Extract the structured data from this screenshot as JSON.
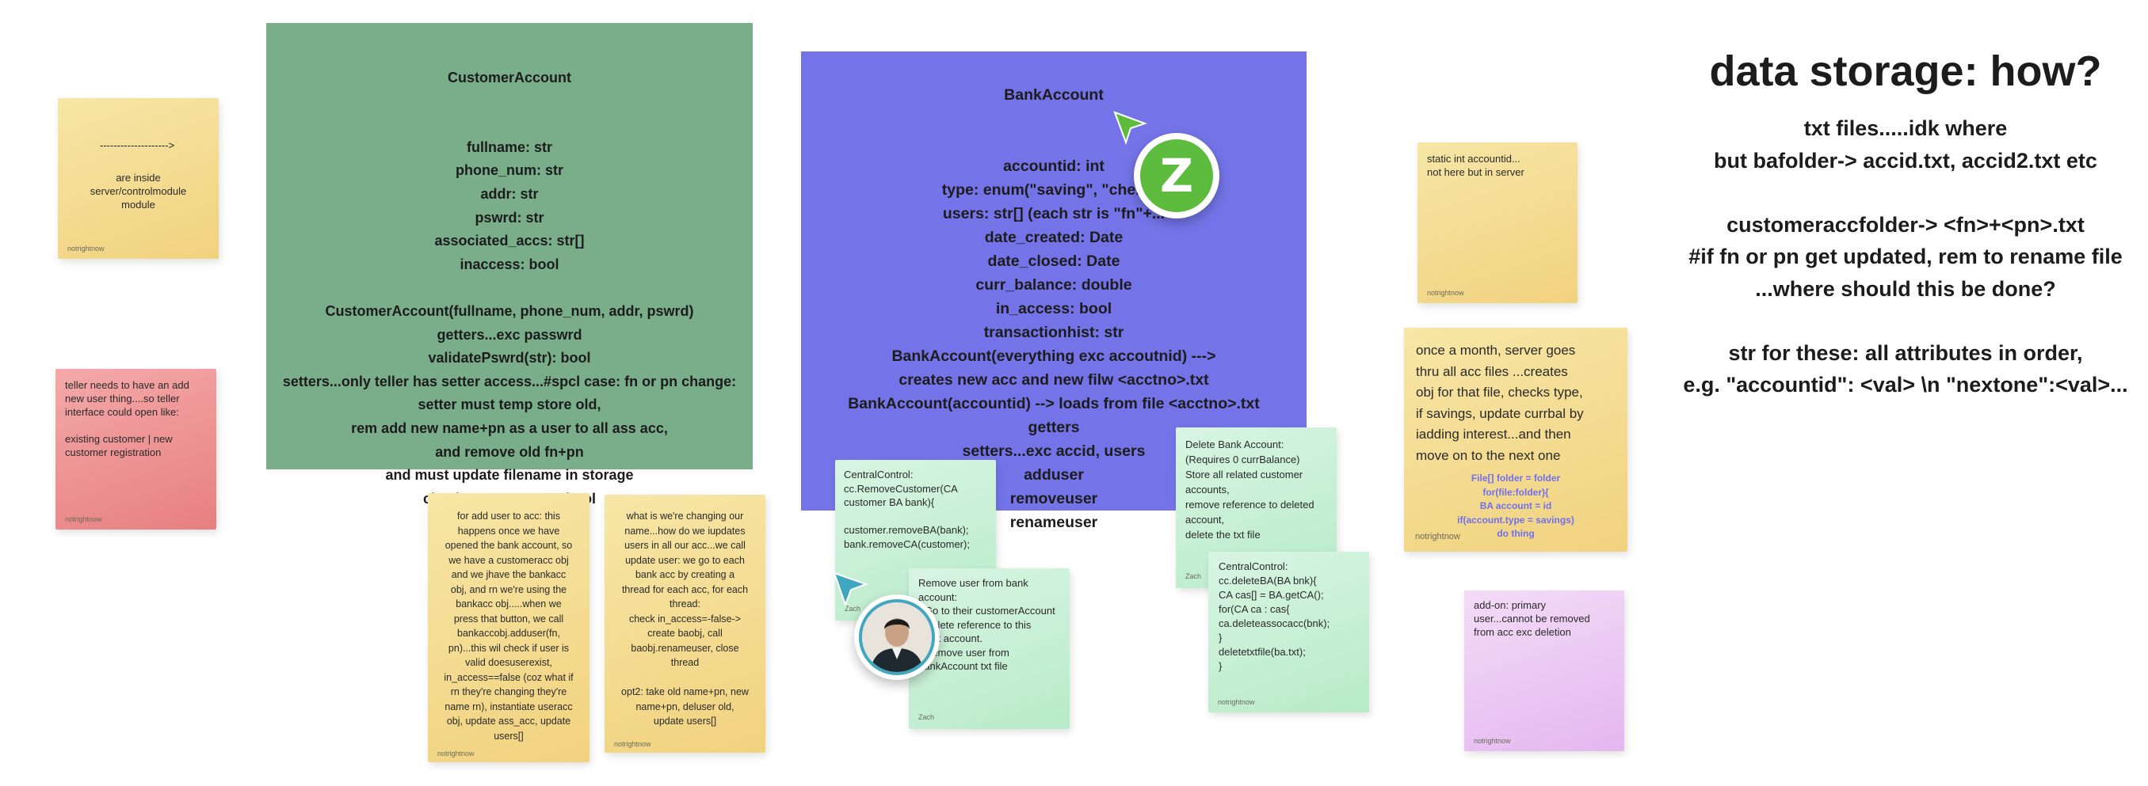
{
  "customer_account": {
    "title": "CustomerAccount",
    "body": "fullname: str\nphone_num: str\naddr: str\npswrd: str\nassociated_accs: str[]\ninaccess: bool\n\nCustomerAccount(fullname, phone_num, addr, pswrd)\ngetters...exc passwrd\nvalidatePswrd(str): bool\nsetters...only teller has setter access...#spcl case: fn or pn change:\nsetter must temp store old,\nrem add new name+pn as a user to all ass acc,\nand remove old fn+pn\nand must update filename in storage\ncheckAccessStatus: bool\nupdateAccess: void\ndelassocacc(ba)",
    "color": "#7aae8b"
  },
  "bank_account": {
    "title": "BankAccount",
    "body": "accountid: int\ntype: enum(\"saving\", \"che..ki..\nusers: str[] (each str is \"fn\"+...\ndate_created: Date\ndate_closed: Date\ncurr_balance: double\nin_access: bool\ntransactionhist: str\nBankAccount(everything exc accoutnid) --->\ncreates new acc and new filw <acctno>.txt\nBankAccount(accountid) --> loads from file <acctno>.txt\ngetters\nsetters...exc accid, users\nadduser\nremoveuser\nrenameuser",
    "color": "#7474e8"
  },
  "data_storage": {
    "title": "data storage: how?",
    "body": "txt files.....idk where\nbut bafolder-> accid.txt, accid2.txt etc\n\ncustomeraccfolder-> <fn>+<pn>.txt\n#if fn or pn get updated, rem to rename file\n...where should this be done?\n\nstr for these: all attributes in order,\ne.g. \"accountid\": <val> \\n \"nextone\":<val>..."
  },
  "notes": {
    "server_module": {
      "arrow": "-------------------->",
      "text": "are inside\nserver/controlmodule\nmodule",
      "author": "notrightnow"
    },
    "teller": {
      "text": "teller needs to have an add\nnew user thing....so teller\ninterface could open like:\n\nexisting customer | new\ncustomer registration",
      "author": "notrightnow"
    },
    "add_user": {
      "text": "for add user to acc: this\nhappens once we have\nopened the bank account, so\nwe have a customeracc obj\nand we jhave the bankacc\nobj, and rn we're using the\nbankacc obj.....when we\npress that button, we call\nbankaccobj.adduser(fn,\npn)...this wil check if user is\nvalid doesuserexist,\nin_access==false (coz what if\nrn they're changing they're\nname rn), instantiate useracc\nobj, update ass_acc, update\nusers[]",
      "author": "notrightnow"
    },
    "change_name": {
      "text": "what is we're changing our\nname...how do we iupdates\nusers in all our acc...we call\nupdate user: we go to each\nbank acc by creating a\nthread for each acc, for each\nthread:\ncheck in_access=-false->\ncreate baobj, call\nbaobj.renameuser, close\nthread\n\nopt2: take old name+pn, new\nname+pn, deluser old,\nupdate users[]",
      "author": "notrightnow"
    },
    "central_remove_customer": {
      "text": "CentralControl:\ncc.RemoveCustomer(CA\ncustomer BA bank){\n\ncustomer.removeBA(bank);\nbank.removeCA(customer);",
      "author": "Zach"
    },
    "remove_user": {
      "text": "Remove user from bank\naccount:\n- Go to their customerAccount\n- Delete reference to this\nbank account.\n- Remove user from\nbankAccount txt file",
      "author": "Zach"
    },
    "delete_bank": {
      "text": "Delete Bank Account:\n(Requires 0 currBalance)\nStore all related customer\naccounts,\nremove reference to deleted\naccount,\ndelete the txt file",
      "author": "Zach"
    },
    "central_delete": {
      "text": "CentralControl:\ncc.deleteBA(BA bnk){\nCA cas[] = BA.getCA();\nfor(CA ca : cas{\n    ca.deleteassocacc(bnk);\n}\ndeletetxtfile(ba.txt);\n}",
      "author": "notrightnow"
    },
    "static_int": {
      "text": "static int accountid...\nnot here but in server",
      "author": "notrightnow"
    },
    "monthly": {
      "text": "once a month, server goes\nthru all acc files ...creates\nobj for that file, checks type,\nif savings, update currbal by\niadding interest...and then\nmove on to the next one",
      "code": "File[] folder = folder\nfor(file:folder){\nBA account = id\nif(account.type = savings)\ndo thing",
      "author": "notrightnow"
    },
    "primary_user": {
      "text": "add-on: primary\nuser...cannot be removed\nfrom acc exc deletion",
      "author": "notrightnow"
    }
  },
  "collaborators": {
    "z_badge": "Z",
    "z_color": "#5dbb3e",
    "cursor_green": "#5dbb3e",
    "cursor_teal": "#3fa7bf"
  }
}
